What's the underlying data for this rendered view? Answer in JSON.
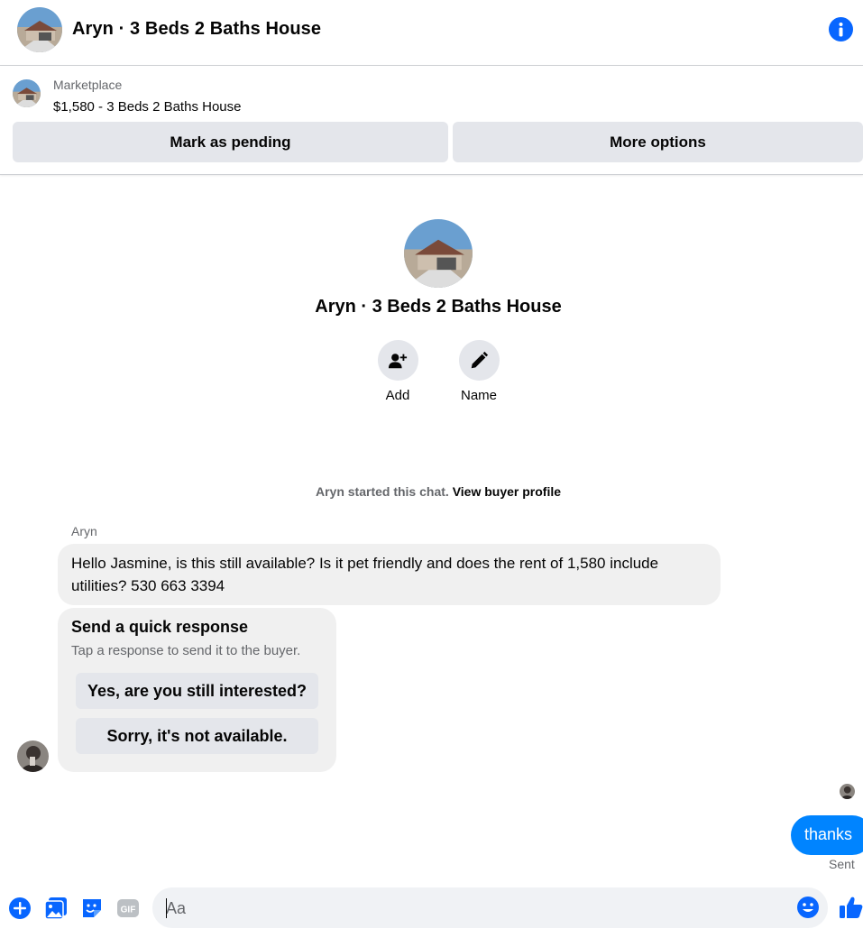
{
  "header": {
    "title": "Aryn · 3 Beds 2 Baths House",
    "avatar_icon": "house-photo",
    "info_icon": "info-icon"
  },
  "listing": {
    "source": "Marketplace",
    "price_title": "$1,580 - 3 Beds 2 Baths House",
    "mark_pending_label": "Mark as pending",
    "more_options_label": "More options"
  },
  "profile": {
    "name": "Aryn · 3 Beds 2 Baths House",
    "add_label": "Add",
    "name_label": "Name"
  },
  "chat": {
    "started_text": "Aryn started this chat.",
    "view_profile_link": "View buyer profile",
    "sender_name": "Aryn",
    "incoming_message": "Hello Jasmine, is this still available? Is it pet friendly and does the rent of 1,580 include utilities? 530 663 3394",
    "quick_title": "Send a quick response",
    "quick_subtitle": "Tap a response to send it to the buyer.",
    "quick_yes": "Yes, are you still interested?",
    "quick_no": "Sorry, it's not available.",
    "outgoing_message": "thanks",
    "sent_status": "Sent"
  },
  "composer": {
    "placeholder": "Aa",
    "icons": [
      "plus-icon",
      "photo-icon",
      "sticker-icon",
      "gif-icon",
      "emoji-icon",
      "like-icon"
    ]
  },
  "colors": {
    "accent": "#0866ff",
    "bubble_out": "#0084ff",
    "button_bg": "#e4e6eb",
    "bubble_in": "#f0f0f0"
  }
}
